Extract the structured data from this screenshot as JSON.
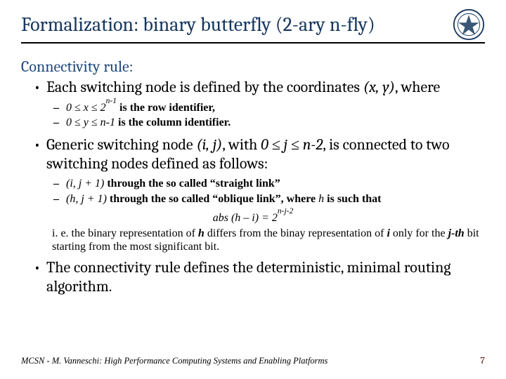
{
  "title": "Formalization: binary butterfly (2-ary n-fly)",
  "subhead": "Connectivity rule:",
  "bullets": {
    "b1a": "Each switching node is defined by the coordinates ",
    "b1a_coord": "(x, y)",
    "b1a_tail": ", where",
    "sub1a_pre": "0 ",
    "sub1a_le1": "≤",
    "sub1a_mid": " x ",
    "sub1a_le2": "≤",
    "sub1a_pow": " 2",
    "sub1a_exp": "n-1",
    "sub1a_tail": " is the row identifier,",
    "sub1b_pre": "0 ",
    "sub1b_le1": "≤",
    "sub1b_mid": " y ",
    "sub1b_le2": "≤",
    "sub1b_after": " n-1",
    "sub1b_tail": " is the column identifier.",
    "b2_pre": "Generic switching node ",
    "b2_ij": "(i, j)",
    "b2_mid1": ", with ",
    "b2_zero": "0 ",
    "b2_le1": "≤",
    "b2_j": " j ",
    "b2_le2": "≤",
    "b2_n2": " n-2",
    "b2_tail": ", is connected to two switching nodes defined as follows:",
    "sub2a_node": "(i, j + 1)",
    "sub2a_mid": " through the so called ",
    "sub2a_q": "“straight link”",
    "sub2b_node": "(h, j + 1)",
    "sub2b_mid": " through the so called ",
    "sub2b_q": "“oblique link”",
    "sub2b_tail1": ", where ",
    "sub2b_h": "h",
    "sub2b_tail2": " is such that",
    "eq_lhs": "abs (h – i) = 2",
    "eq_exp": "n-j-2",
    "note_pre": "i. e. the binary representation of ",
    "note_h": "h",
    "note_mid1": " differs from the binay representation of ",
    "note_i": "i",
    "note_mid2": " only for the ",
    "note_jth": "j-th",
    "note_tail": " bit starting from the most significant bit.",
    "b3": "The connectivity rule defines the deterministic, minimal routing algorithm."
  },
  "footer": "MCSN  -   M. Vanneschi: High Performance Computing Systems and Enabling Platforms",
  "page": "7"
}
